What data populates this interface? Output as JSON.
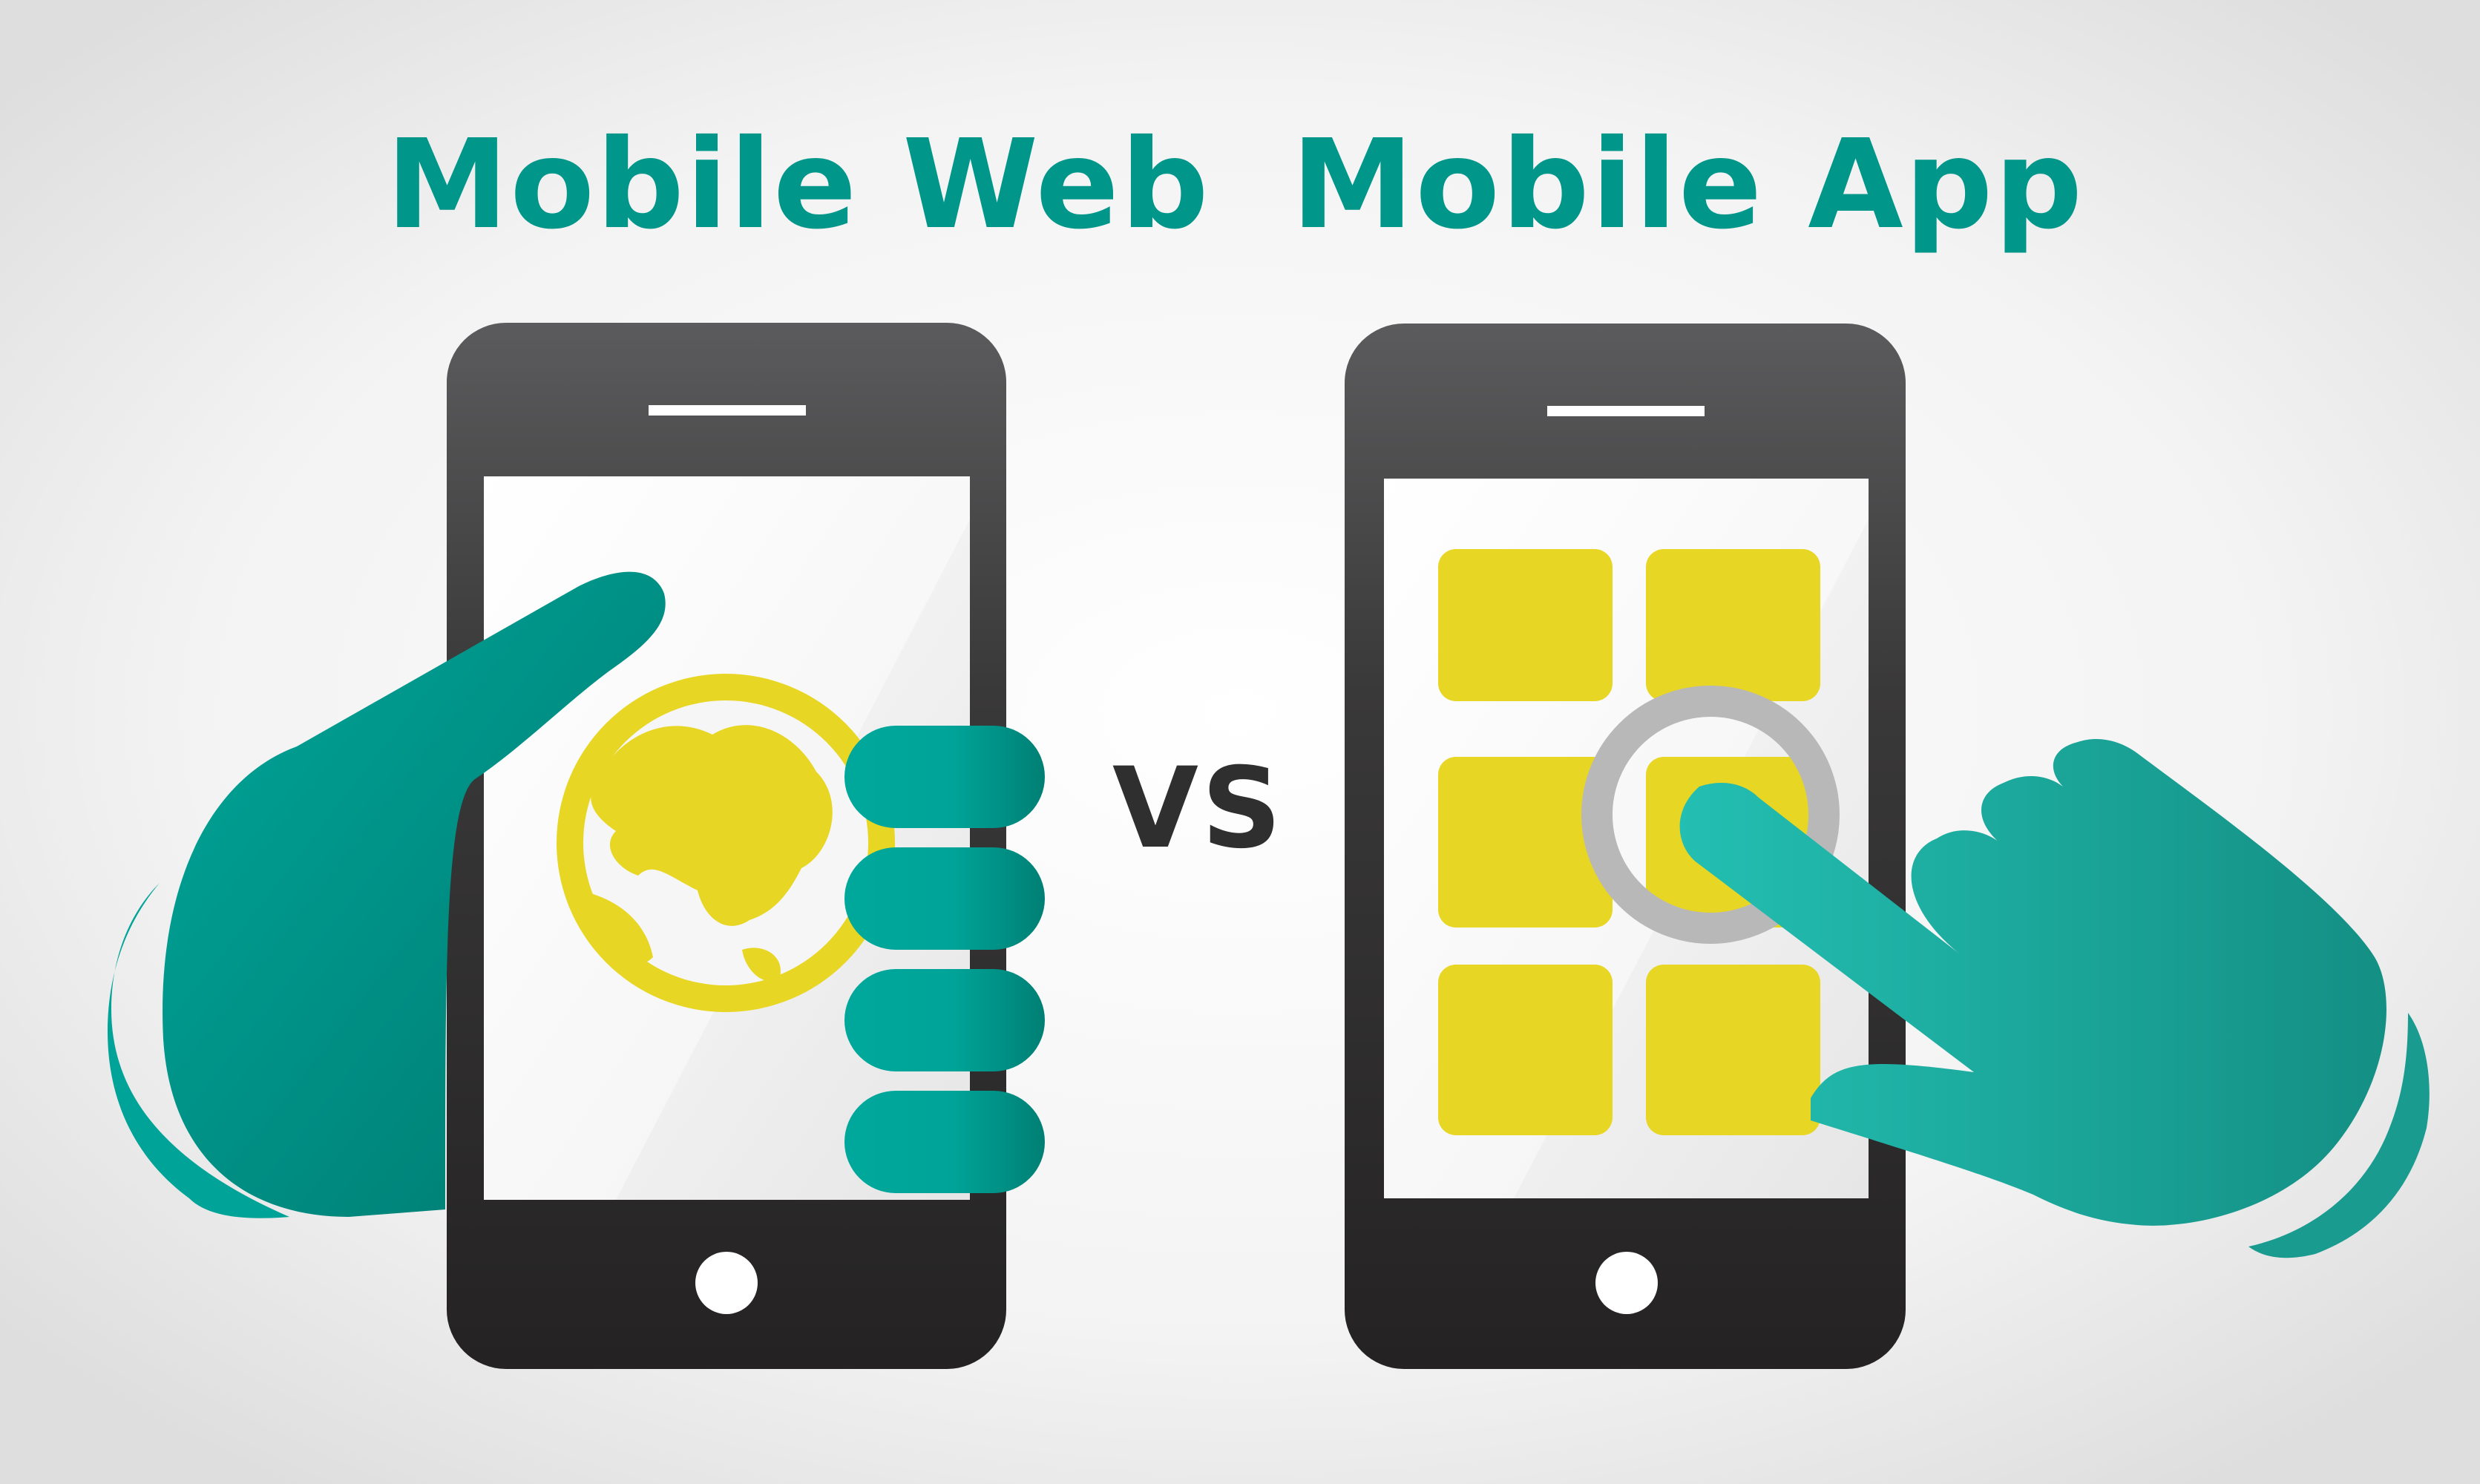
{
  "titles": {
    "web": "Mobile Web",
    "app": "Mobile App",
    "versus": "VS"
  },
  "colors": {
    "heading": "#00968a",
    "versus": "#2f2f2f",
    "phone_body": "#2c2a2a",
    "screen": "#f4f4f4",
    "hand_web": "#00a397",
    "hand_app": "#1fb7ab",
    "globe": "#e8d624",
    "tile": "#e8d624",
    "tap_ring": "#b8b8b8",
    "background": "#f2f2f2"
  },
  "icons": {
    "web_screen": "globe-icon",
    "app_screen": "app-grid-icon",
    "touch": "tap-ring-icon"
  }
}
